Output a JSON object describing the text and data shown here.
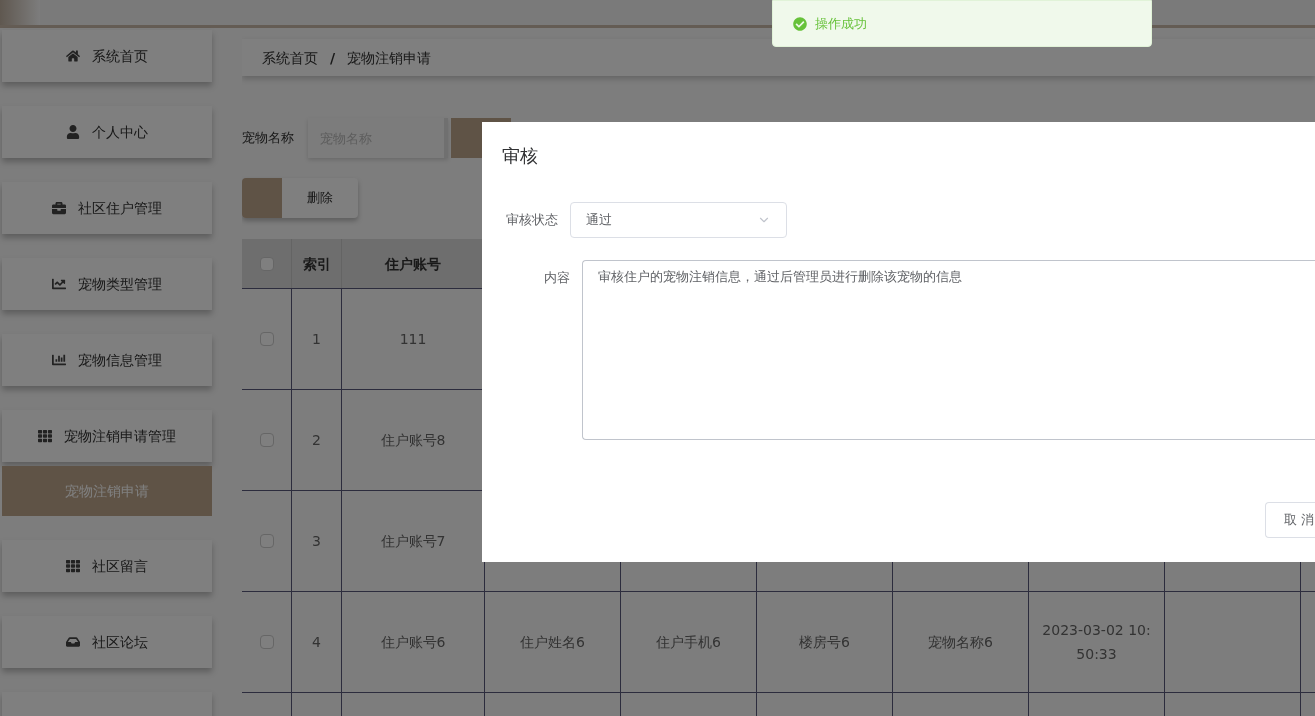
{
  "toast": {
    "text": "操作成功"
  },
  "sidebar": {
    "items": [
      {
        "label": "系统首页",
        "selected": false
      },
      {
        "label": "个人中心",
        "selected": false
      },
      {
        "label": "社区住户管理",
        "selected": false
      },
      {
        "label": "宠物类型管理",
        "selected": false
      },
      {
        "label": "宠物信息管理",
        "selected": false
      },
      {
        "label": "宠物注销申请管理",
        "selected": false,
        "children": [
          {
            "label": "宠物注销申请",
            "selected": true
          }
        ]
      },
      {
        "label": "社区留言",
        "selected": false
      },
      {
        "label": "社区论坛",
        "selected": false
      }
    ]
  },
  "breadcrumb": [
    "系统首页",
    "宠物注销申请"
  ],
  "breadcrumb_separator": "/",
  "search": {
    "label": "宠物名称",
    "placeholder": "宠物名称"
  },
  "delete_button": "删除",
  "table": {
    "select_all_checked": false,
    "columns": [
      "索引",
      "住户账号"
    ],
    "rows": [
      {
        "checked": false,
        "cells": [
          "1",
          "111"
        ]
      },
      {
        "checked": false,
        "cells": [
          "2",
          "住户账号8"
        ]
      },
      {
        "checked": false,
        "cells": [
          "3",
          "住户账号7"
        ]
      },
      {
        "checked": false,
        "cells": [
          "4",
          "住户账号6",
          "住户姓名6",
          "住户手机6",
          "楼房号6",
          "宠物名称6",
          "2023-03-02 10:50:33"
        ]
      }
    ]
  },
  "dialog": {
    "title": "审核",
    "status_label": "审核状态",
    "status_value": "通过",
    "content_label": "内容",
    "content_value": "审核住户的宠物注销信息，通过后管理员进行删除该宠物的信息",
    "cancel_button": "取 消"
  }
}
